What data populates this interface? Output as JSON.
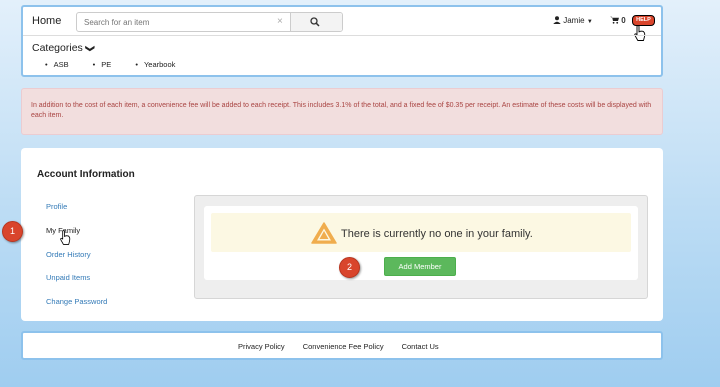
{
  "header": {
    "home_label": "Home",
    "search_placeholder": "Search for an item",
    "clear_symbol": "×",
    "user_name": "Jamie",
    "user_caret": "▼",
    "cart_count": "0",
    "help_label": "HELP"
  },
  "categories": {
    "label": "Categories",
    "chevron": "❯",
    "items": [
      "ASB",
      "PE",
      "Yearbook"
    ]
  },
  "alert": {
    "text": "In addition to the cost of each item, a convenience fee will be added to each receipt. This includes 3.1% of the total, and a fixed fee of $0.35 per receipt. An estimate of these costs will be displayed with each item."
  },
  "account": {
    "title": "Account Information",
    "nav": [
      "Profile",
      "My Family",
      "Order History",
      "Unpaid Items",
      "Change Password"
    ],
    "active_item": "My Family",
    "empty_message": "There is currently no one in your family.",
    "add_button": "Add Member"
  },
  "markers": [
    "1",
    "2"
  ],
  "footer": {
    "links": [
      "Privacy Policy",
      "Convenience Fee Policy",
      "Contact Us"
    ]
  },
  "icons": [
    "search-icon",
    "user-icon",
    "cart-icon",
    "hand-cursor-icon",
    "warning-icon"
  ],
  "colors": {
    "help_red": "#d9452c",
    "marker_red": "#d9452c",
    "alert_bg": "#f2dede",
    "alert_text": "#a94442",
    "warning_bg": "#fcf8e3",
    "warning_icon": "#f0ad4e",
    "success": "#5cb85c",
    "link": "#337ab7",
    "border_blue": "#8dc2ec"
  }
}
